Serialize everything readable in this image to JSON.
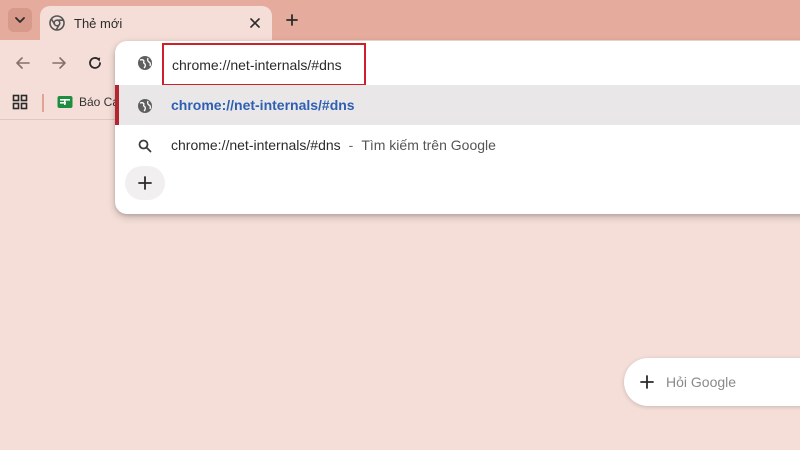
{
  "tab": {
    "title": "Thẻ mới"
  },
  "bookmarks": {
    "items": [
      {
        "label": "Báo Cá"
      }
    ]
  },
  "omnibox": {
    "input_value": "chrome://net-internals/#dns",
    "suggestions": [
      {
        "text": "chrome://net-internals/#dns",
        "icon": "globe-icon"
      },
      {
        "text": "chrome://net-internals/#dns",
        "separator": "-",
        "description": "Tìm kiếm trên Google",
        "icon": "search-icon"
      }
    ]
  },
  "ask_google": {
    "label": "Hỏi Google"
  },
  "colors": {
    "tabstrip": "#e5ab9c",
    "page_background": "#f5ded8",
    "highlight_border": "#cc2128",
    "suggestion_link": "#2f5fb3",
    "bookmark_icon_green": "#1e8e3e"
  }
}
